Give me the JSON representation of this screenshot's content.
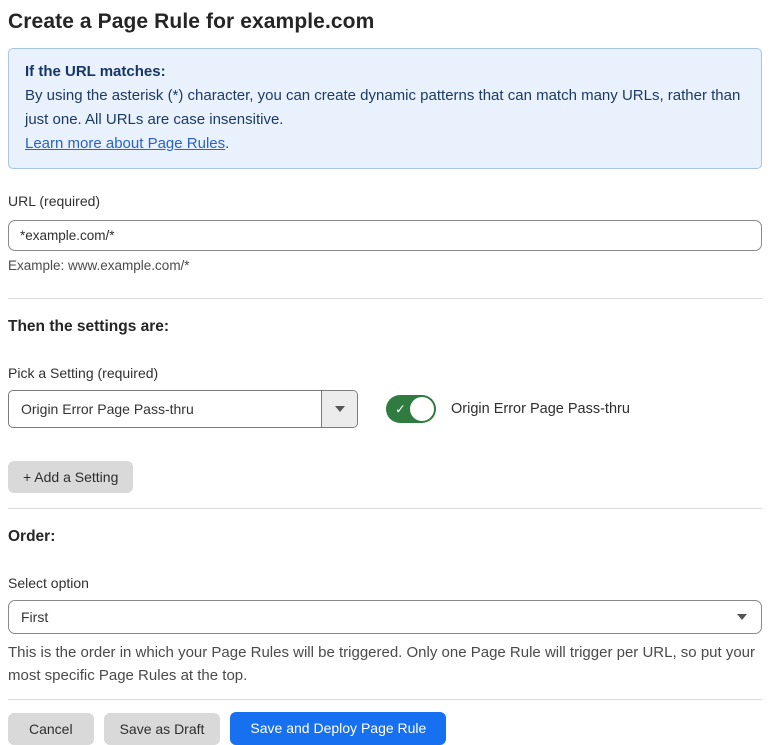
{
  "page": {
    "title": "Create a Page Rule for example.com"
  },
  "info_box": {
    "heading": "If the URL matches:",
    "body": "By using the asterisk (*) character, you can create dynamic patterns that can match many URLs, rather than just one. All URLs are case insensitive.",
    "link_text": "Learn more about Page Rules",
    "link_suffix": "."
  },
  "url_field": {
    "label": "URL (required)",
    "value": "*example.com/*",
    "example": "Example: www.example.com/*"
  },
  "settings": {
    "heading": "Then the settings are:",
    "pick_label": "Pick a Setting (required)",
    "selected_option": "Origin Error Page Pass-thru",
    "toggle_label": "Origin Error Page Pass-thru",
    "toggle_state": "on",
    "toggle_check_glyph": "✓",
    "add_button_label": "+ Add a Setting"
  },
  "order": {
    "heading": "Order:",
    "label": "Select option",
    "selected_option": "First",
    "help": "This is the order in which your Page Rules will be triggered. Only one Page Rule will trigger per URL, so put your most specific Page Rules at the top."
  },
  "actions": {
    "cancel_label": "Cancel",
    "save_draft_label": "Save as Draft",
    "save_deploy_label": "Save and Deploy Page Rule"
  },
  "colors": {
    "info_bg": "#e9f2fc",
    "info_border": "#a7c6e6",
    "info_text": "#1d3a66",
    "link_blue": "#2b62c9",
    "toggle_green": "#2f7b40",
    "primary_blue": "#1670f0",
    "gray_button": "#d9d9d9"
  }
}
